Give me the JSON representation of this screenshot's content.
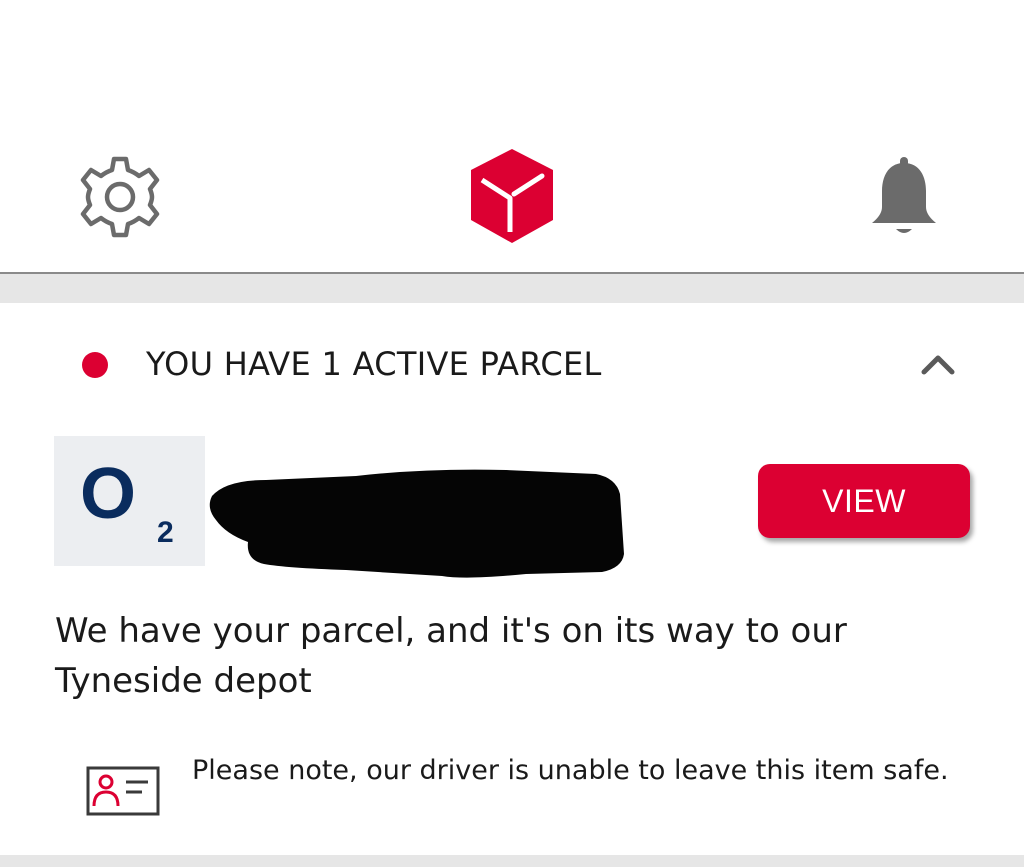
{
  "header": {
    "settings_icon": "gear-icon",
    "logo_icon": "dpd-parcel-logo",
    "notifications_icon": "bell-icon",
    "brand_color": "#dc0032"
  },
  "parcels": {
    "active_label": "YOU HAVE 1 ACTIVE PARCEL",
    "collapse_icon": "chevron-up-icon",
    "status_dot_color": "#dc0032"
  },
  "parcel": {
    "sender_logo": {
      "main": "O",
      "sub": "2"
    },
    "view_label": "VIEW",
    "status": "We have your parcel, and it's on its way to our Tyneside depot",
    "note_icon": "id-card-icon",
    "note": "Please note, our driver is unable to leave this item safe."
  }
}
